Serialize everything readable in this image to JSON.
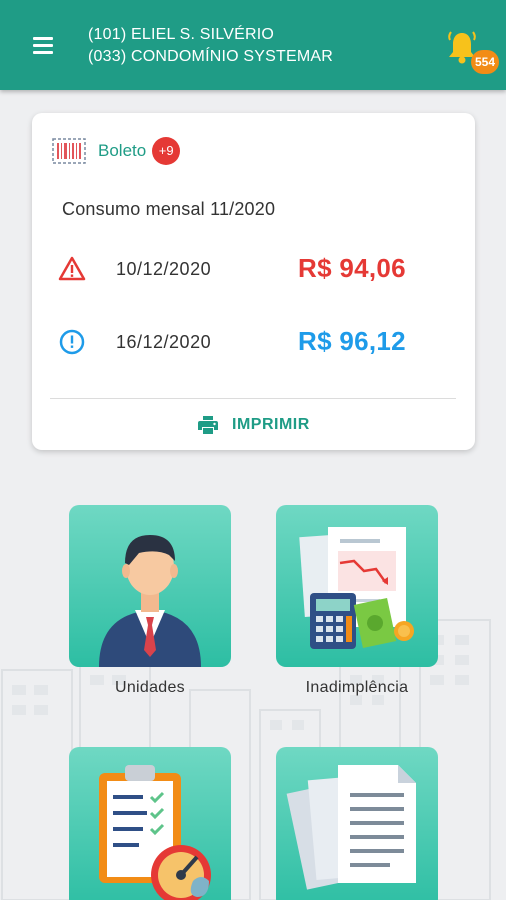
{
  "header": {
    "line1": "(101) ELIEL S. SILVÉRIO",
    "line2": "(033) CONDOMÍNIO SYSTEMAR",
    "notifications_count": "554"
  },
  "card": {
    "title": "Boleto",
    "badge": "+9",
    "consumo": "Consumo mensal 11/2020",
    "bills": [
      {
        "status_icon": "warning-triangle-icon",
        "date": "10/12/2020",
        "amount": "R$ 94,06",
        "color": "#e53935"
      },
      {
        "status_icon": "info-circle-icon",
        "date": "16/12/2020",
        "amount": "R$ 96,12",
        "color": "#1e9be9"
      }
    ],
    "print_label": "IMPRIMIR"
  },
  "tiles": [
    {
      "label": "Unidades",
      "icon": "businessman-icon"
    },
    {
      "label": "Inadimplência",
      "icon": "finance-report-icon"
    },
    {
      "label": "",
      "icon": "clipboard-gauge-icon"
    },
    {
      "label": "",
      "icon": "documents-icon"
    }
  ],
  "colors": {
    "primary": "#1f9c86",
    "accent": "#f28c16",
    "danger": "#e53935",
    "info": "#1e9be9"
  }
}
